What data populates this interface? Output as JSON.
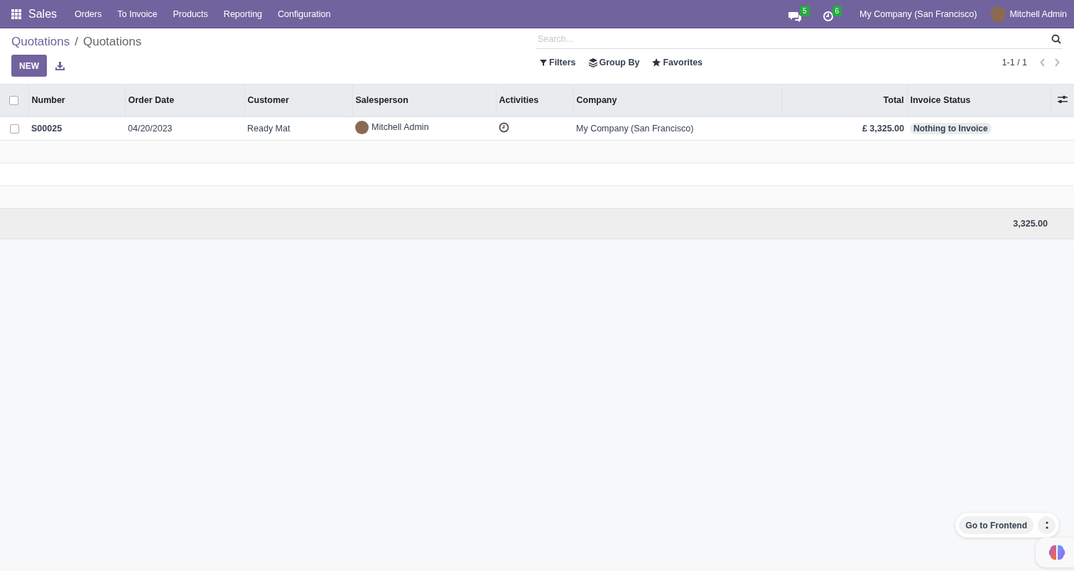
{
  "navbar": {
    "app": "Sales",
    "menu": [
      "Orders",
      "To Invoice",
      "Products",
      "Reporting",
      "Configuration"
    ],
    "messages_count": "5",
    "activities_count": "6",
    "company": "My Company (San Francisco)",
    "user": "Mitchell Admin"
  },
  "breadcrumb": {
    "parent": "Quotations",
    "separator": "/",
    "current": "Quotations"
  },
  "control_panel": {
    "new_button": "NEW",
    "search": {
      "placeholder": "Search..."
    },
    "filters": [
      {
        "kind": "filter",
        "label": "Filters"
      },
      {
        "kind": "group",
        "label": "Group By"
      },
      {
        "kind": "favorite",
        "label": "Favorites"
      }
    ],
    "pager": "1-1 / 1"
  },
  "table": {
    "all_selected": false,
    "columns": [
      {
        "label": "Number",
        "kind": "bold"
      },
      {
        "label": "Order Date",
        "kind": "text"
      },
      {
        "label": "Customer",
        "kind": "text"
      },
      {
        "label": "Salesperson",
        "kind": "avatar"
      },
      {
        "label": "Activities",
        "kind": "activity"
      },
      {
        "label": "Company",
        "kind": "text"
      },
      {
        "label": "Total",
        "kind": "money"
      },
      {
        "label": "Invoice Status",
        "kind": "badge"
      }
    ],
    "rows": [
      {
        "selected": false,
        "cells": [
          "S00025",
          "04/20/2023",
          "Ready Mat",
          "Mitchell Admin",
          "",
          "My Company (San Francisco)",
          "£ 3,325.00",
          "Nothing to Invoice"
        ]
      }
    ],
    "footer_total": "3,325.00"
  },
  "floating": {
    "button": "Go to Frontend"
  }
}
